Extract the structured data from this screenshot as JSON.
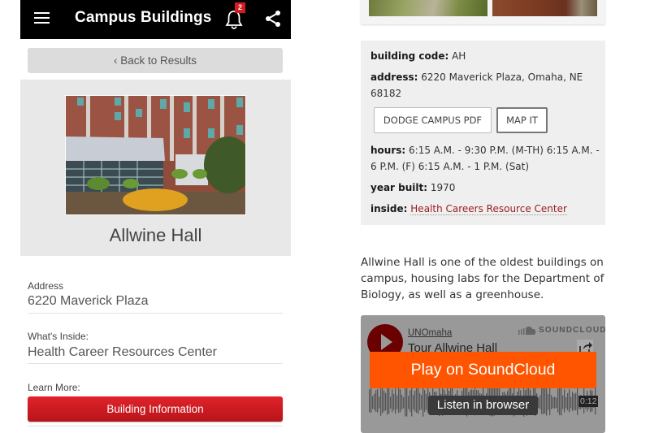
{
  "app": {
    "title": "Campus Buildings",
    "notification_count": "2",
    "back_label": "‹ Back to Results",
    "building_name": "Allwine Hall",
    "fields": [
      {
        "label": "Address",
        "value": "6220 Maverick Plaza"
      },
      {
        "label": "What's Inside:",
        "value": "Health Career Resources Center"
      }
    ],
    "learn_more_label": "Learn More:",
    "building_info_button": "Building Information",
    "icons": {
      "menu": "hamburger-icon",
      "notifications": "bell-icon",
      "share": "share-icon"
    },
    "colors": {
      "topbar": "#000000",
      "accent": "#d71920",
      "badge": "#d71920"
    }
  },
  "web": {
    "info": {
      "code_label": "building code:",
      "code_value": "AH",
      "address_label": "address:",
      "address_value": "6220 Maverick Plaza, Omaha, NE 68182",
      "pdf_button": "DODGE CAMPUS PDF",
      "map_button": "MAP IT",
      "hours_label": "hours:",
      "hours_value": "6:15 A.M. - 9:30 P.M. (M-TH) 6:15 A.M. - 6 P.M. (F) 6:15 A.M. - 1 P.M. (Sat)",
      "year_label": "year built:",
      "year_value": "1970",
      "inside_label": "inside:",
      "inside_value": "Health Careers Resource Center"
    },
    "description": "Allwine Hall is one of the oldest buildings on campus, housing labs for the Department of Biology, as well as a greenhouse.",
    "soundcloud": {
      "user": "UNOmaha",
      "track": "Tour Allwine Hall",
      "brand": "SOUNDCLOUD",
      "play_button": "Play on SoundCloud",
      "listen_button": "Listen in browser",
      "duration": "0:12",
      "colors": {
        "play": "#ff5500",
        "avatar": "#6b0000"
      }
    },
    "colors": {
      "link": "#9b1b1f"
    }
  }
}
